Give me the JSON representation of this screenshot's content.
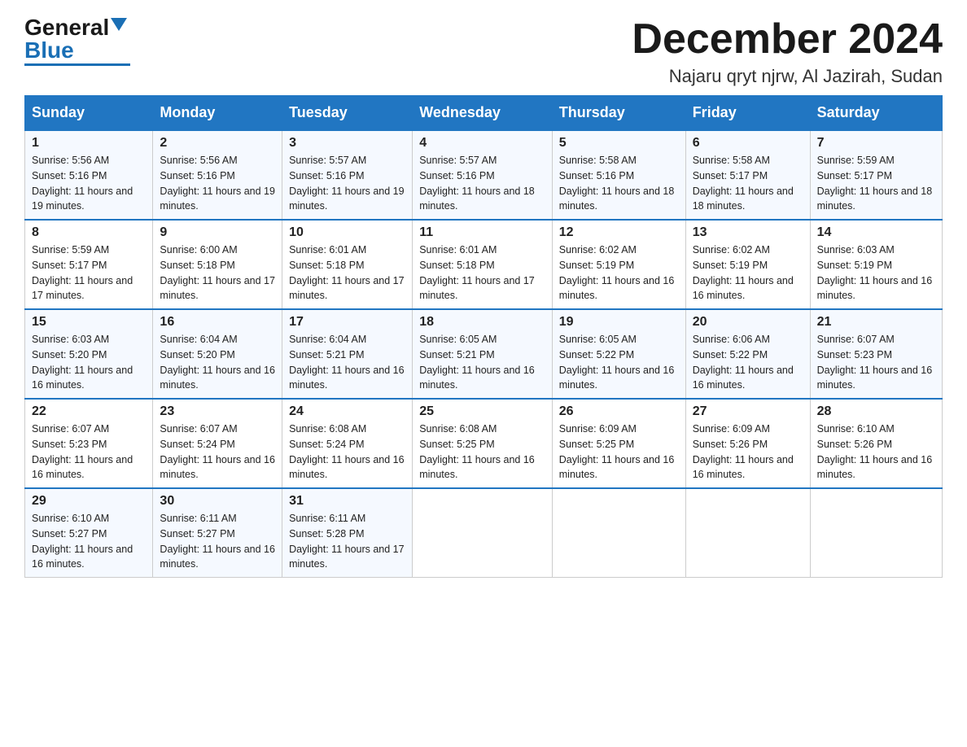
{
  "header": {
    "logo_general": "General",
    "logo_blue": "Blue",
    "month_title": "December 2024",
    "subtitle": "Najaru qryt njrw, Al Jazirah, Sudan"
  },
  "days_of_week": [
    "Sunday",
    "Monday",
    "Tuesday",
    "Wednesday",
    "Thursday",
    "Friday",
    "Saturday"
  ],
  "weeks": [
    [
      {
        "day": "1",
        "sunrise": "Sunrise: 5:56 AM",
        "sunset": "Sunset: 5:16 PM",
        "daylight": "Daylight: 11 hours and 19 minutes."
      },
      {
        "day": "2",
        "sunrise": "Sunrise: 5:56 AM",
        "sunset": "Sunset: 5:16 PM",
        "daylight": "Daylight: 11 hours and 19 minutes."
      },
      {
        "day": "3",
        "sunrise": "Sunrise: 5:57 AM",
        "sunset": "Sunset: 5:16 PM",
        "daylight": "Daylight: 11 hours and 19 minutes."
      },
      {
        "day": "4",
        "sunrise": "Sunrise: 5:57 AM",
        "sunset": "Sunset: 5:16 PM",
        "daylight": "Daylight: 11 hours and 18 minutes."
      },
      {
        "day": "5",
        "sunrise": "Sunrise: 5:58 AM",
        "sunset": "Sunset: 5:16 PM",
        "daylight": "Daylight: 11 hours and 18 minutes."
      },
      {
        "day": "6",
        "sunrise": "Sunrise: 5:58 AM",
        "sunset": "Sunset: 5:17 PM",
        "daylight": "Daylight: 11 hours and 18 minutes."
      },
      {
        "day": "7",
        "sunrise": "Sunrise: 5:59 AM",
        "sunset": "Sunset: 5:17 PM",
        "daylight": "Daylight: 11 hours and 18 minutes."
      }
    ],
    [
      {
        "day": "8",
        "sunrise": "Sunrise: 5:59 AM",
        "sunset": "Sunset: 5:17 PM",
        "daylight": "Daylight: 11 hours and 17 minutes."
      },
      {
        "day": "9",
        "sunrise": "Sunrise: 6:00 AM",
        "sunset": "Sunset: 5:18 PM",
        "daylight": "Daylight: 11 hours and 17 minutes."
      },
      {
        "day": "10",
        "sunrise": "Sunrise: 6:01 AM",
        "sunset": "Sunset: 5:18 PM",
        "daylight": "Daylight: 11 hours and 17 minutes."
      },
      {
        "day": "11",
        "sunrise": "Sunrise: 6:01 AM",
        "sunset": "Sunset: 5:18 PM",
        "daylight": "Daylight: 11 hours and 17 minutes."
      },
      {
        "day": "12",
        "sunrise": "Sunrise: 6:02 AM",
        "sunset": "Sunset: 5:19 PM",
        "daylight": "Daylight: 11 hours and 16 minutes."
      },
      {
        "day": "13",
        "sunrise": "Sunrise: 6:02 AM",
        "sunset": "Sunset: 5:19 PM",
        "daylight": "Daylight: 11 hours and 16 minutes."
      },
      {
        "day": "14",
        "sunrise": "Sunrise: 6:03 AM",
        "sunset": "Sunset: 5:19 PM",
        "daylight": "Daylight: 11 hours and 16 minutes."
      }
    ],
    [
      {
        "day": "15",
        "sunrise": "Sunrise: 6:03 AM",
        "sunset": "Sunset: 5:20 PM",
        "daylight": "Daylight: 11 hours and 16 minutes."
      },
      {
        "day": "16",
        "sunrise": "Sunrise: 6:04 AM",
        "sunset": "Sunset: 5:20 PM",
        "daylight": "Daylight: 11 hours and 16 minutes."
      },
      {
        "day": "17",
        "sunrise": "Sunrise: 6:04 AM",
        "sunset": "Sunset: 5:21 PM",
        "daylight": "Daylight: 11 hours and 16 minutes."
      },
      {
        "day": "18",
        "sunrise": "Sunrise: 6:05 AM",
        "sunset": "Sunset: 5:21 PM",
        "daylight": "Daylight: 11 hours and 16 minutes."
      },
      {
        "day": "19",
        "sunrise": "Sunrise: 6:05 AM",
        "sunset": "Sunset: 5:22 PM",
        "daylight": "Daylight: 11 hours and 16 minutes."
      },
      {
        "day": "20",
        "sunrise": "Sunrise: 6:06 AM",
        "sunset": "Sunset: 5:22 PM",
        "daylight": "Daylight: 11 hours and 16 minutes."
      },
      {
        "day": "21",
        "sunrise": "Sunrise: 6:07 AM",
        "sunset": "Sunset: 5:23 PM",
        "daylight": "Daylight: 11 hours and 16 minutes."
      }
    ],
    [
      {
        "day": "22",
        "sunrise": "Sunrise: 6:07 AM",
        "sunset": "Sunset: 5:23 PM",
        "daylight": "Daylight: 11 hours and 16 minutes."
      },
      {
        "day": "23",
        "sunrise": "Sunrise: 6:07 AM",
        "sunset": "Sunset: 5:24 PM",
        "daylight": "Daylight: 11 hours and 16 minutes."
      },
      {
        "day": "24",
        "sunrise": "Sunrise: 6:08 AM",
        "sunset": "Sunset: 5:24 PM",
        "daylight": "Daylight: 11 hours and 16 minutes."
      },
      {
        "day": "25",
        "sunrise": "Sunrise: 6:08 AM",
        "sunset": "Sunset: 5:25 PM",
        "daylight": "Daylight: 11 hours and 16 minutes."
      },
      {
        "day": "26",
        "sunrise": "Sunrise: 6:09 AM",
        "sunset": "Sunset: 5:25 PM",
        "daylight": "Daylight: 11 hours and 16 minutes."
      },
      {
        "day": "27",
        "sunrise": "Sunrise: 6:09 AM",
        "sunset": "Sunset: 5:26 PM",
        "daylight": "Daylight: 11 hours and 16 minutes."
      },
      {
        "day": "28",
        "sunrise": "Sunrise: 6:10 AM",
        "sunset": "Sunset: 5:26 PM",
        "daylight": "Daylight: 11 hours and 16 minutes."
      }
    ],
    [
      {
        "day": "29",
        "sunrise": "Sunrise: 6:10 AM",
        "sunset": "Sunset: 5:27 PM",
        "daylight": "Daylight: 11 hours and 16 minutes."
      },
      {
        "day": "30",
        "sunrise": "Sunrise: 6:11 AM",
        "sunset": "Sunset: 5:27 PM",
        "daylight": "Daylight: 11 hours and 16 minutes."
      },
      {
        "day": "31",
        "sunrise": "Sunrise: 6:11 AM",
        "sunset": "Sunset: 5:28 PM",
        "daylight": "Daylight: 11 hours and 17 minutes."
      },
      null,
      null,
      null,
      null
    ]
  ]
}
